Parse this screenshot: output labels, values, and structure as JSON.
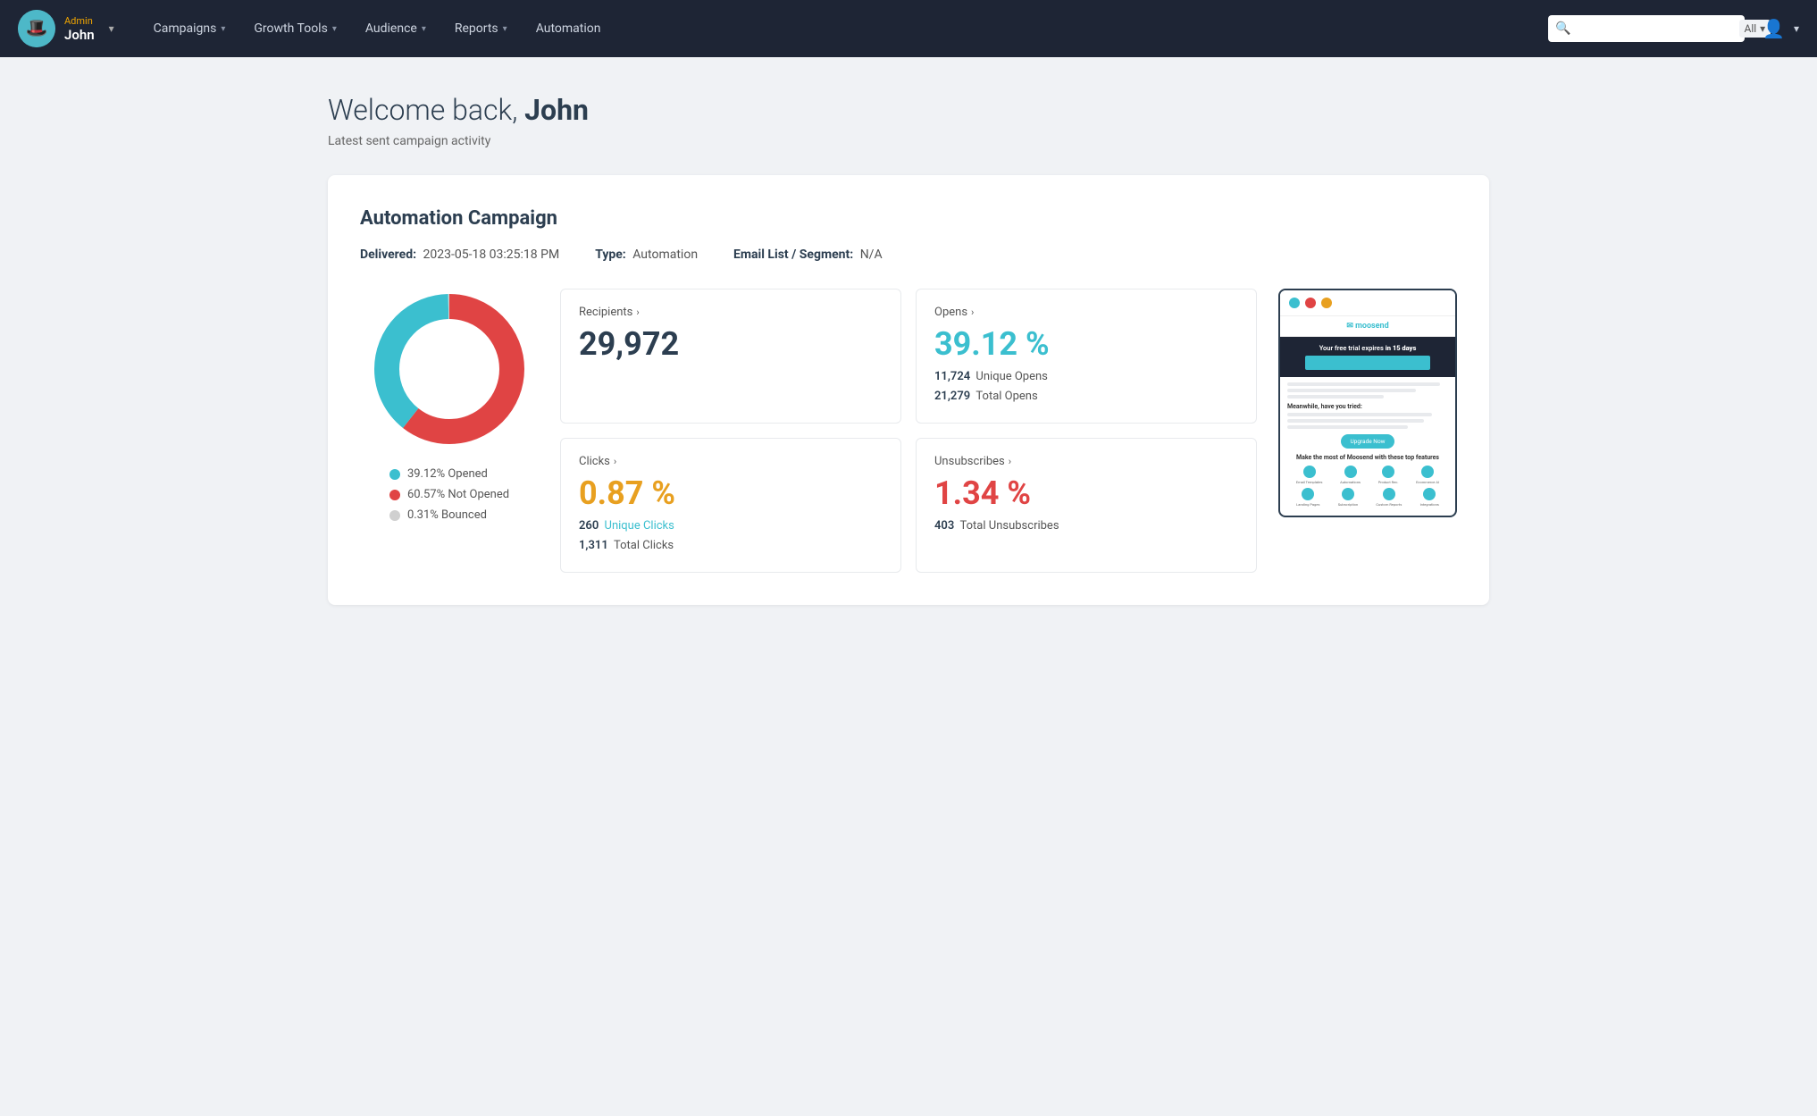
{
  "nav": {
    "user_role": "Admin",
    "user_name": "John",
    "logo_emoji": "🎩",
    "menu_items": [
      {
        "label": "Campaigns",
        "has_dropdown": true
      },
      {
        "label": "Growth Tools",
        "has_dropdown": true
      },
      {
        "label": "Audience",
        "has_dropdown": true
      },
      {
        "label": "Reports",
        "has_dropdown": true
      },
      {
        "label": "Automation",
        "has_dropdown": false
      }
    ],
    "search_placeholder": "",
    "search_filter_label": "All"
  },
  "page": {
    "welcome_prefix": "Welcome back, ",
    "welcome_name": "John",
    "subtitle": "Latest sent campaign activity"
  },
  "campaign": {
    "title": "Automation Campaign",
    "delivered_label": "Delivered:",
    "delivered_value": "2023-05-18 03:25:18 PM",
    "type_label": "Type:",
    "type_value": "Automation",
    "segment_label": "Email List / Segment:",
    "segment_value": "N/A"
  },
  "donut": {
    "opened_pct": 39.12,
    "not_opened_pct": 60.57,
    "bounced_pct": 0.31,
    "opened_color": "#3bbfcf",
    "not_opened_color": "#e04444",
    "bounced_color": "#d0d0d0",
    "legend": [
      {
        "color": "#3bbfcf",
        "label": "39.12% Opened"
      },
      {
        "color": "#e04444",
        "label": "60.57% Not Opened"
      },
      {
        "color": "#d0d0d0",
        "label": "0.31% Bounced"
      }
    ]
  },
  "metrics": {
    "recipients": {
      "label": "Recipients",
      "value": "29,972",
      "value_color": "dark"
    },
    "opens": {
      "label": "Opens",
      "value": "39.12 %",
      "value_color": "cyan",
      "sub1_count": "11,724",
      "sub1_label": "Unique Opens",
      "sub2_count": "21,279",
      "sub2_label": "Total Opens"
    },
    "clicks": {
      "label": "Clicks",
      "value": "0.87 %",
      "value_color": "orange",
      "sub1_count": "260",
      "sub1_label": "Unique Clicks",
      "sub2_count": "1,311",
      "sub2_label": "Total Clicks"
    },
    "unsubscribes": {
      "label": "Unsubscribes",
      "value": "1.34 %",
      "value_color": "red",
      "sub1_count": "403",
      "sub1_label": "Total Unsubscribes"
    }
  },
  "preview": {
    "dot_colors": [
      "#3bbfcf",
      "#e04444",
      "#e8a020"
    ],
    "header_text": "Your free trial expires in 15 days",
    "logo_text": "✉ moosend",
    "heading1": "Meanwhile, have you tried:",
    "btn_text": "Upgrade Now",
    "features_title": "Make the most of Moosend with these top features",
    "feature_items": [
      "Email Templates",
      "Automations",
      "Product Recommendations",
      "Ecommerce AI",
      "Landing Pages",
      "Subscription Forms",
      "Custom Reports",
      "Integrations"
    ]
  }
}
